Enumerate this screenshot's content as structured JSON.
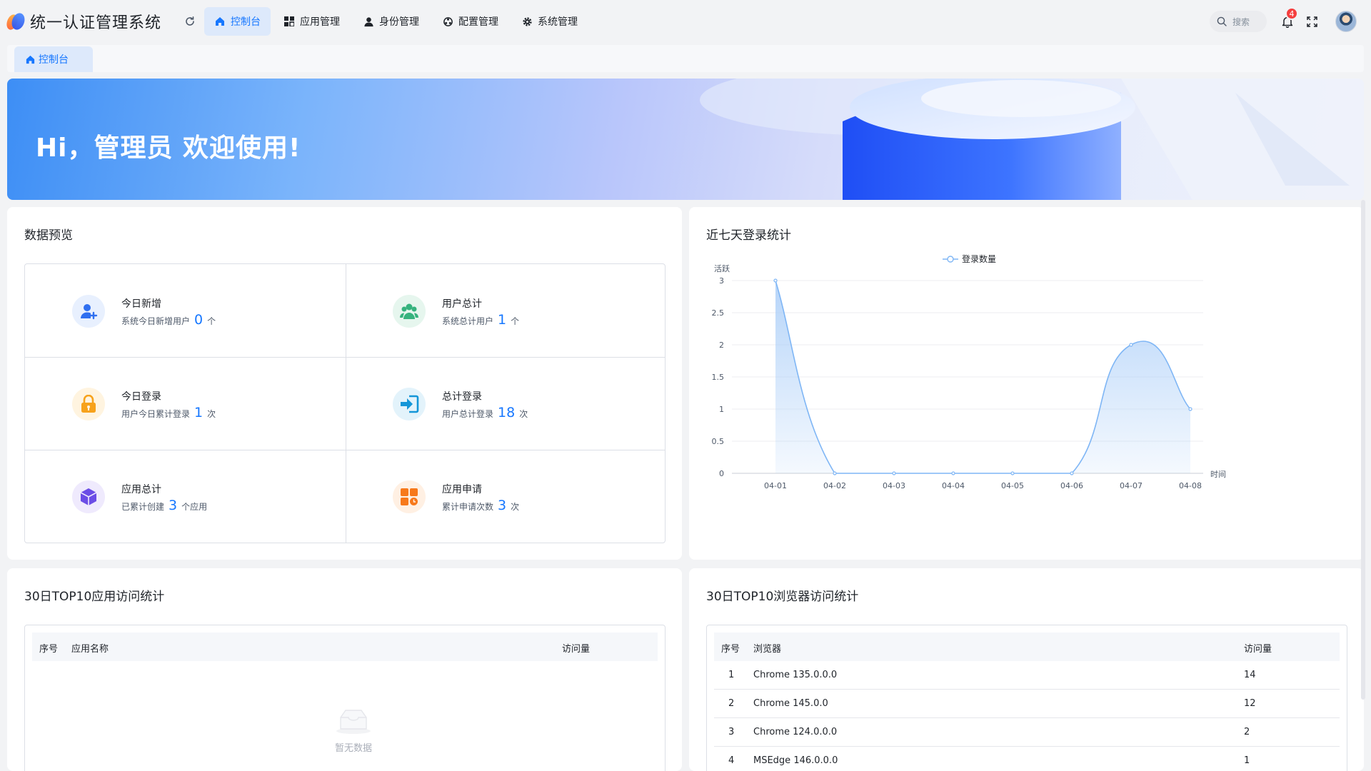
{
  "app": {
    "title": "统一认证管理系统"
  },
  "nav": {
    "items": [
      {
        "label": "控制台",
        "icon": "home-icon",
        "active": true
      },
      {
        "label": "应用管理",
        "icon": "grid-icon",
        "active": false
      },
      {
        "label": "身份管理",
        "icon": "user-icon",
        "active": false
      },
      {
        "label": "配置管理",
        "icon": "config-icon",
        "active": false
      },
      {
        "label": "系统管理",
        "icon": "gear-icon",
        "active": false
      }
    ]
  },
  "header": {
    "search_placeholder": "搜索",
    "notification_count": "4"
  },
  "tabs": [
    {
      "label": "控制台",
      "icon": "home-icon"
    }
  ],
  "banner": {
    "greeting": "Hi，管理员 欢迎使用!"
  },
  "overview": {
    "title": "数据预览",
    "stats": [
      {
        "name": "今日新增",
        "desc": "系统今日新增用户",
        "value": "0",
        "unit": "个",
        "icon": "add-user-icon",
        "color": "#2f6ff0"
      },
      {
        "name": "用户总计",
        "desc": "系统总计用户",
        "value": "1",
        "unit": "个",
        "icon": "users-icon",
        "color": "#36b37e"
      },
      {
        "name": "今日登录",
        "desc": "用户今日累计登录",
        "value": "1",
        "unit": "次",
        "icon": "lock-icon",
        "color": "#f7a21b"
      },
      {
        "name": "总计登录",
        "desc": "用户总计登录",
        "value": "18",
        "unit": "次",
        "icon": "login-icon",
        "color": "#1496d8"
      },
      {
        "name": "应用总计",
        "desc": "已累计创建",
        "value": "3",
        "unit": "个应用",
        "icon": "cube-icon",
        "color": "#6b4de6"
      },
      {
        "name": "应用申请",
        "desc": "累计申请次数",
        "value": "3",
        "unit": "次",
        "icon": "apps-icon",
        "color": "#f7791b"
      }
    ]
  },
  "login_chart": {
    "title": "近七天登录统计",
    "legend": "登录数量",
    "colors": {
      "line": "#7fb6f5",
      "area": "#a9cdf8"
    }
  },
  "chart_data": {
    "type": "area",
    "title": "",
    "xlabel": "时间",
    "ylabel": "活跃",
    "categories": [
      "04-01",
      "04-02",
      "04-03",
      "04-04",
      "04-05",
      "04-06",
      "04-07",
      "04-08"
    ],
    "series": [
      {
        "name": "登录数量",
        "values": [
          3,
          0,
          0,
          0,
          0,
          0,
          2,
          1
        ]
      }
    ],
    "ylim": [
      0,
      3
    ],
    "yticks": [
      "0",
      "0.5",
      "1",
      "1.5",
      "2",
      "2.5",
      "3"
    ],
    "grid": true,
    "legend_position": "top-center"
  },
  "app_table": {
    "title": "30日TOP10应用访问统计",
    "columns": [
      "序号",
      "应用名称",
      "访问量"
    ],
    "rows": [],
    "empty_text": "暂无数据"
  },
  "browser_table": {
    "title": "30日TOP10浏览器访问统计",
    "columns": [
      "序号",
      "浏览器",
      "访问量"
    ],
    "rows": [
      {
        "index": "1",
        "name": "Chrome 135.0.0.0",
        "count": "14"
      },
      {
        "index": "2",
        "name": "Chrome 145.0.0",
        "count": "12"
      },
      {
        "index": "3",
        "name": "Chrome 124.0.0.0",
        "count": "2"
      },
      {
        "index": "4",
        "name": "MSEdge 146.0.0.0",
        "count": "1"
      }
    ]
  }
}
